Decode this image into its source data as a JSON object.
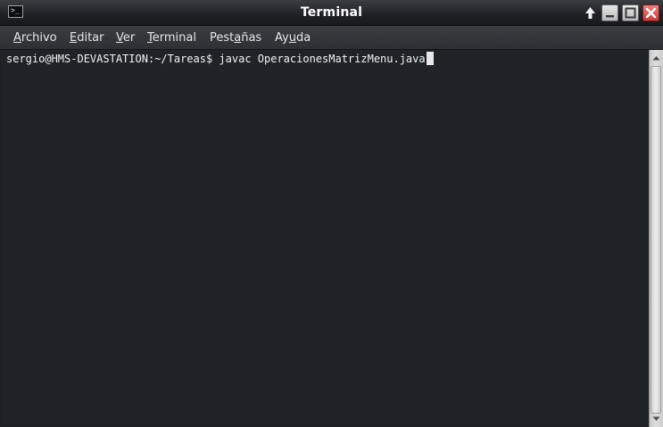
{
  "window": {
    "title": "Terminal",
    "app_icon_glyph": ">_"
  },
  "menubar": {
    "items": [
      {
        "mnemonic": "A",
        "rest": "rchivo"
      },
      {
        "mnemonic": "E",
        "rest": "ditar"
      },
      {
        "mnemonic": "V",
        "rest": "er"
      },
      {
        "mnemonic": "T",
        "rest": "erminal"
      },
      {
        "pre": "Pest",
        "mnemonic": "a",
        "rest": "ñas"
      },
      {
        "pre": "Ay",
        "mnemonic": "u",
        "rest": "da"
      }
    ]
  },
  "terminal": {
    "prompt": "sergio@HMS-DEVASTATION:~/Tareas$ ",
    "command": "javac OperacionesMatrizMenu.java"
  },
  "colors": {
    "terminal_bg": "#202326",
    "terminal_fg": "#f2f2f2",
    "close_button": "#d04a4a"
  },
  "icons": {
    "shade": "arrow-up-icon",
    "minimize": "minimize-icon",
    "maximize": "maximize-icon",
    "close": "close-icon"
  }
}
